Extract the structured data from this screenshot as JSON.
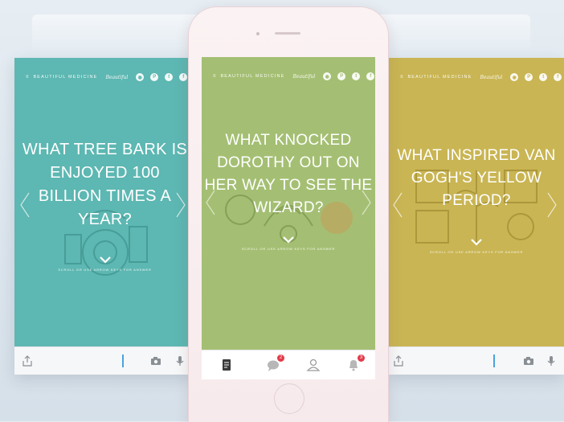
{
  "brand": {
    "name": "BEAUTIFUL MEDICINE",
    "signature": "Beautiful"
  },
  "social": [
    "instagram-icon",
    "pinterest-icon",
    "twitter-icon",
    "facebook-icon"
  ],
  "social_glyphs": {
    "instagram-icon": "◉",
    "pinterest-icon": "P",
    "twitter-icon": "t",
    "facebook-icon": "f"
  },
  "left_card": {
    "question_lines": [
      "WHAT TREE BARK IS",
      "ENJOYED 100",
      "BILLION TIMES A",
      "YEAR?"
    ],
    "hint": "SCROLL OR USE ARROW KEYS FOR ANSWER",
    "color": "#5db7b2"
  },
  "phone_card": {
    "question_lines": [
      "WHAT KNOCKED",
      "DOROTHY OUT ON",
      "HER WAY TO SEE THE",
      "WIZARD?"
    ],
    "hint": "SCROLL OR USE ARROW KEYS FOR ANSWER",
    "color": "#a4bf73",
    "tabs": [
      {
        "name": "notes-tab",
        "badge": ""
      },
      {
        "name": "messages-tab",
        "badge": "2"
      },
      {
        "name": "profile-tab",
        "badge": ""
      },
      {
        "name": "notifications-tab",
        "badge": "3"
      }
    ]
  },
  "right_card": {
    "question_lines": [
      "WHAT INSPIRED VAN",
      "GOGH'S YELLOW",
      "PERIOD?"
    ],
    "hint": "SCROLL OR USE ARROW KEYS FOR ANSWER",
    "color": "#c9b553"
  },
  "colors": {
    "accent_blue": "#4aa3df",
    "badge_red": "#e23b4a",
    "bottombar": "#f6f7f8"
  }
}
